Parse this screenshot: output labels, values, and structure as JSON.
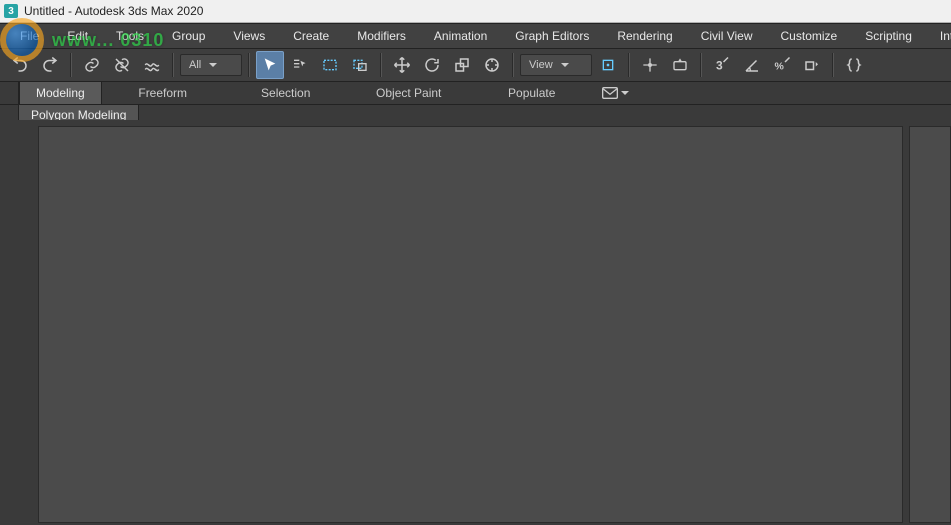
{
  "title": "Untitled - Autodesk 3ds Max 2020",
  "app_icon_text": "3",
  "watermark": "www... 0310",
  "menus": {
    "file": "File",
    "edit": "Edit",
    "tools": "Tools",
    "group": "Group",
    "views": "Views",
    "create": "Create",
    "modifiers": "Modifiers",
    "animation": "Animation",
    "graph_editors": "Graph Editors",
    "rendering": "Rendering",
    "civil_view": "Civil View",
    "customize": "Customize",
    "scripting": "Scripting",
    "interactive": "Interactive"
  },
  "toolbar": {
    "selection_set": "All",
    "named_selection": "View"
  },
  "ribbon": {
    "tabs": {
      "modeling": "Modeling",
      "freeform": "Freeform",
      "selection": "Selection",
      "object_paint": "Object Paint",
      "populate": "Populate"
    },
    "panel": "Polygon Modeling"
  }
}
